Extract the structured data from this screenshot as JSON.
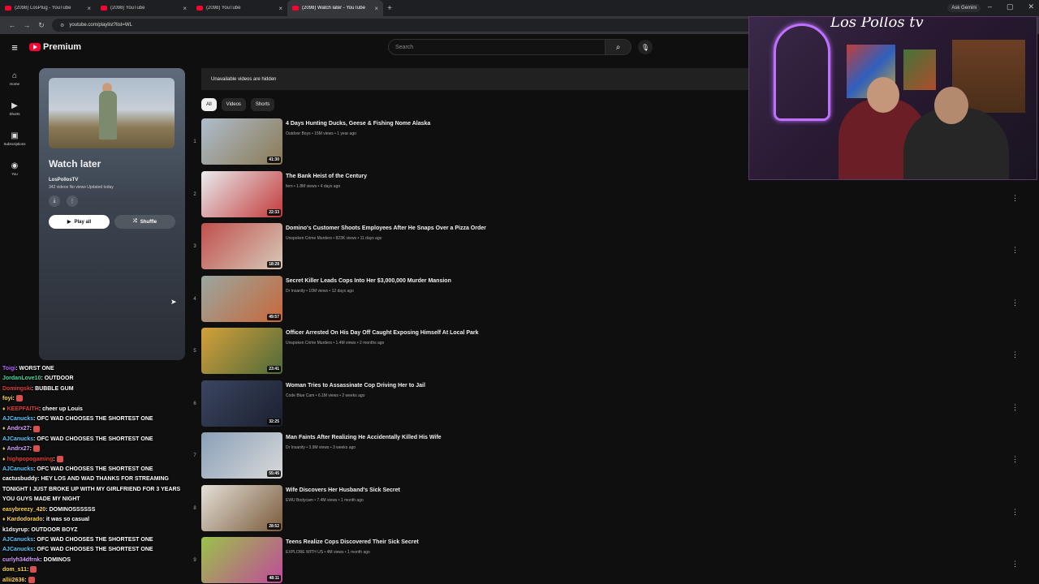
{
  "browser": {
    "tabs": [
      {
        "title": "(2098) LosPlug - YouTube",
        "active": false
      },
      {
        "title": "(2098) YouTube",
        "active": false
      },
      {
        "title": "(2098) YouTube",
        "active": false
      },
      {
        "title": "(2098) Watch later - YouTube",
        "active": true
      }
    ],
    "ask_gemini": "Ask Gemini",
    "url": "youtube.com/playlist?list=WL"
  },
  "header": {
    "logo": "Premium",
    "search_placeholder": "Search"
  },
  "guide": [
    {
      "label": "Home",
      "icon": "home-icon",
      "glyph": "⌂"
    },
    {
      "label": "Shorts",
      "icon": "shorts-icon",
      "glyph": "▶"
    },
    {
      "label": "Subscriptions",
      "icon": "subscriptions-icon",
      "glyph": "▣"
    },
    {
      "label": "You",
      "icon": "you-icon",
      "glyph": "◉"
    }
  ],
  "playlist": {
    "title": "Watch later",
    "owner": "LosPollosTV",
    "meta": "342 videos  No views  Updated today",
    "play_all": "Play all",
    "shuffle": "Shuffle"
  },
  "banner": "Unavailable videos are hidden",
  "chips": [
    "All",
    "Videos",
    "Shorts"
  ],
  "videos": [
    {
      "index": "1",
      "title": "4 Days Hunting Ducks, Geese & Fishing Nome Alaska",
      "meta": "Outdoor Boys • 15M views • 1 year ago",
      "duration": "41:30",
      "thumb": [
        "#aebdcc",
        "#8b7a55"
      ]
    },
    {
      "index": "2",
      "title": "The Bank Heist of the Century",
      "meta": "fern • 1.8M views • 4 days ago",
      "duration": "22:33",
      "thumb": [
        "#e9ecef",
        "#c23a3a"
      ]
    },
    {
      "index": "3",
      "title": "Domino's Customer Shoots Employees After He Snaps Over a Pizza Order",
      "meta": "Unspoken Crime Murders • 823K views • 11 days ago",
      "duration": "18:28",
      "thumb": [
        "#c0504d",
        "#d7c9b8"
      ]
    },
    {
      "index": "4",
      "title": "Secret Killer Leads Cops Into Her $3,000,000 Murder Mansion",
      "meta": "Dr Insanity • 10M views • 12 days ago",
      "duration": "49:57",
      "thumb": [
        "#9aa7a0",
        "#c7683a"
      ]
    },
    {
      "index": "5",
      "title": "Officer Arrested On His Day Off Caught Exposing Himself At Local Park",
      "meta": "Unspoken Crime Murders • 1.4M views • 2 months ago",
      "duration": "23:41",
      "thumb": [
        "#d4a03a",
        "#4f6a3a"
      ]
    },
    {
      "index": "6",
      "title": "Woman Tries to Assassinate Cop Driving Her to Jail",
      "meta": "Code Blue Cam • 6.1M views • 2 weeks ago",
      "duration": "32:25",
      "thumb": [
        "#3a4560",
        "#1c2030"
      ]
    },
    {
      "index": "7",
      "title": "Man Faints After Realizing He Accidentally Killed His Wife",
      "meta": "Dr Insanity • 3.9M views • 3 weeks ago",
      "duration": "55:45",
      "thumb": [
        "#8aa0b8",
        "#d9d9d9"
      ]
    },
    {
      "index": "8",
      "title": "Wife Discovers Her Husband's Sick Secret",
      "meta": "EWU Bodycam • 7.4M views • 1 month ago",
      "duration": "28:52",
      "thumb": [
        "#e4e0d8",
        "#7a5a3a"
      ]
    },
    {
      "index": "9",
      "title": "Teens Realize Cops Discovered Their Sick Secret",
      "meta": "EXPLORE WITH US • 4M views • 1 month ago",
      "duration": "48:11",
      "thumb": [
        "#9bc24a",
        "#c04a9a"
      ]
    }
  ],
  "stream": {
    "signature": "Los Pollos tv"
  },
  "chat": [
    {
      "user": "Toigi",
      "color": "#b267ff",
      "text": "WORST ONE",
      "badge": false,
      "emote": false
    },
    {
      "user": "JordanLove10",
      "color": "#4fd8a0",
      "text": "OUTDOOR",
      "badge": false,
      "emote": false
    },
    {
      "user": "Domingski",
      "color": "#e0403c",
      "text": "BUBBLE GUM",
      "badge": false,
      "emote": false
    },
    {
      "user": "foyi",
      "color": "#ffd54a",
      "text": "",
      "badge": false,
      "emote": true
    },
    {
      "user": "KEEPFAITH",
      "color": "#e0403c",
      "text": "cheer up Louis",
      "badge": true,
      "emote": false
    },
    {
      "user": "AJCanucks",
      "color": "#5fc7ff",
      "text": "OFC WAD CHOOSES THE SHORTEST ONE",
      "badge": false,
      "emote": false
    },
    {
      "user": "Andrx27",
      "color": "#d9a0ff",
      "text": "",
      "badge": true,
      "emote": true
    },
    {
      "user": "AJCanucks",
      "color": "#5fc7ff",
      "text": "OFC WAD CHOOSES THE SHORTEST ONE",
      "badge": false,
      "emote": false
    },
    {
      "user": "Andrx27",
      "color": "#d9a0ff",
      "text": "",
      "badge": true,
      "emote": true
    },
    {
      "user": "highpopogaming",
      "color": "#e0403c",
      "text": "",
      "badge": true,
      "emote": true
    },
    {
      "user": "AJCanucks",
      "color": "#5fc7ff",
      "text": "OFC WAD CHOOSES THE SHORTEST ONE",
      "badge": false,
      "emote": false
    },
    {
      "user": "cactusbuddy",
      "color": "#ffffff",
      "text": "HEY LOS AND WAD THANKS FOR STREAMING TONIGHT I JUST BROKE UP WITH MY GIRLFRIEND FOR 3 YEARS YOU GUYS MADE MY NIGHT",
      "badge": false,
      "emote": false
    },
    {
      "user": "easybreezy_420",
      "color": "#ffd54a",
      "text": "DOMINOSSSSSS",
      "badge": false,
      "emote": false
    },
    {
      "user": "Kardodorado",
      "color": "#ffd54a",
      "text": "it was so casual",
      "badge": true,
      "emote": false
    },
    {
      "user": "k1dsyrup",
      "color": "#ffffff",
      "text": "OUTDOOR BOYZ",
      "badge": false,
      "emote": false
    },
    {
      "user": "AJCanucks",
      "color": "#5fc7ff",
      "text": "OFC WAD CHOOSES THE SHORTEST ONE",
      "badge": false,
      "emote": false
    },
    {
      "user": "AJCanucks",
      "color": "#5fc7ff",
      "text": "OFC WAD CHOOSES THE SHORTEST ONE",
      "badge": false,
      "emote": false
    },
    {
      "user": "curlyh34dfrnk",
      "color": "#d9a0ff",
      "text": "DOMINOS",
      "badge": false,
      "emote": false
    },
    {
      "user": "dom_s11",
      "color": "#ffd54a",
      "text": "",
      "badge": false,
      "emote": true
    },
    {
      "user": "allii2636",
      "color": "#ffd54a",
      "text": "",
      "badge": false,
      "emote": true
    }
  ]
}
